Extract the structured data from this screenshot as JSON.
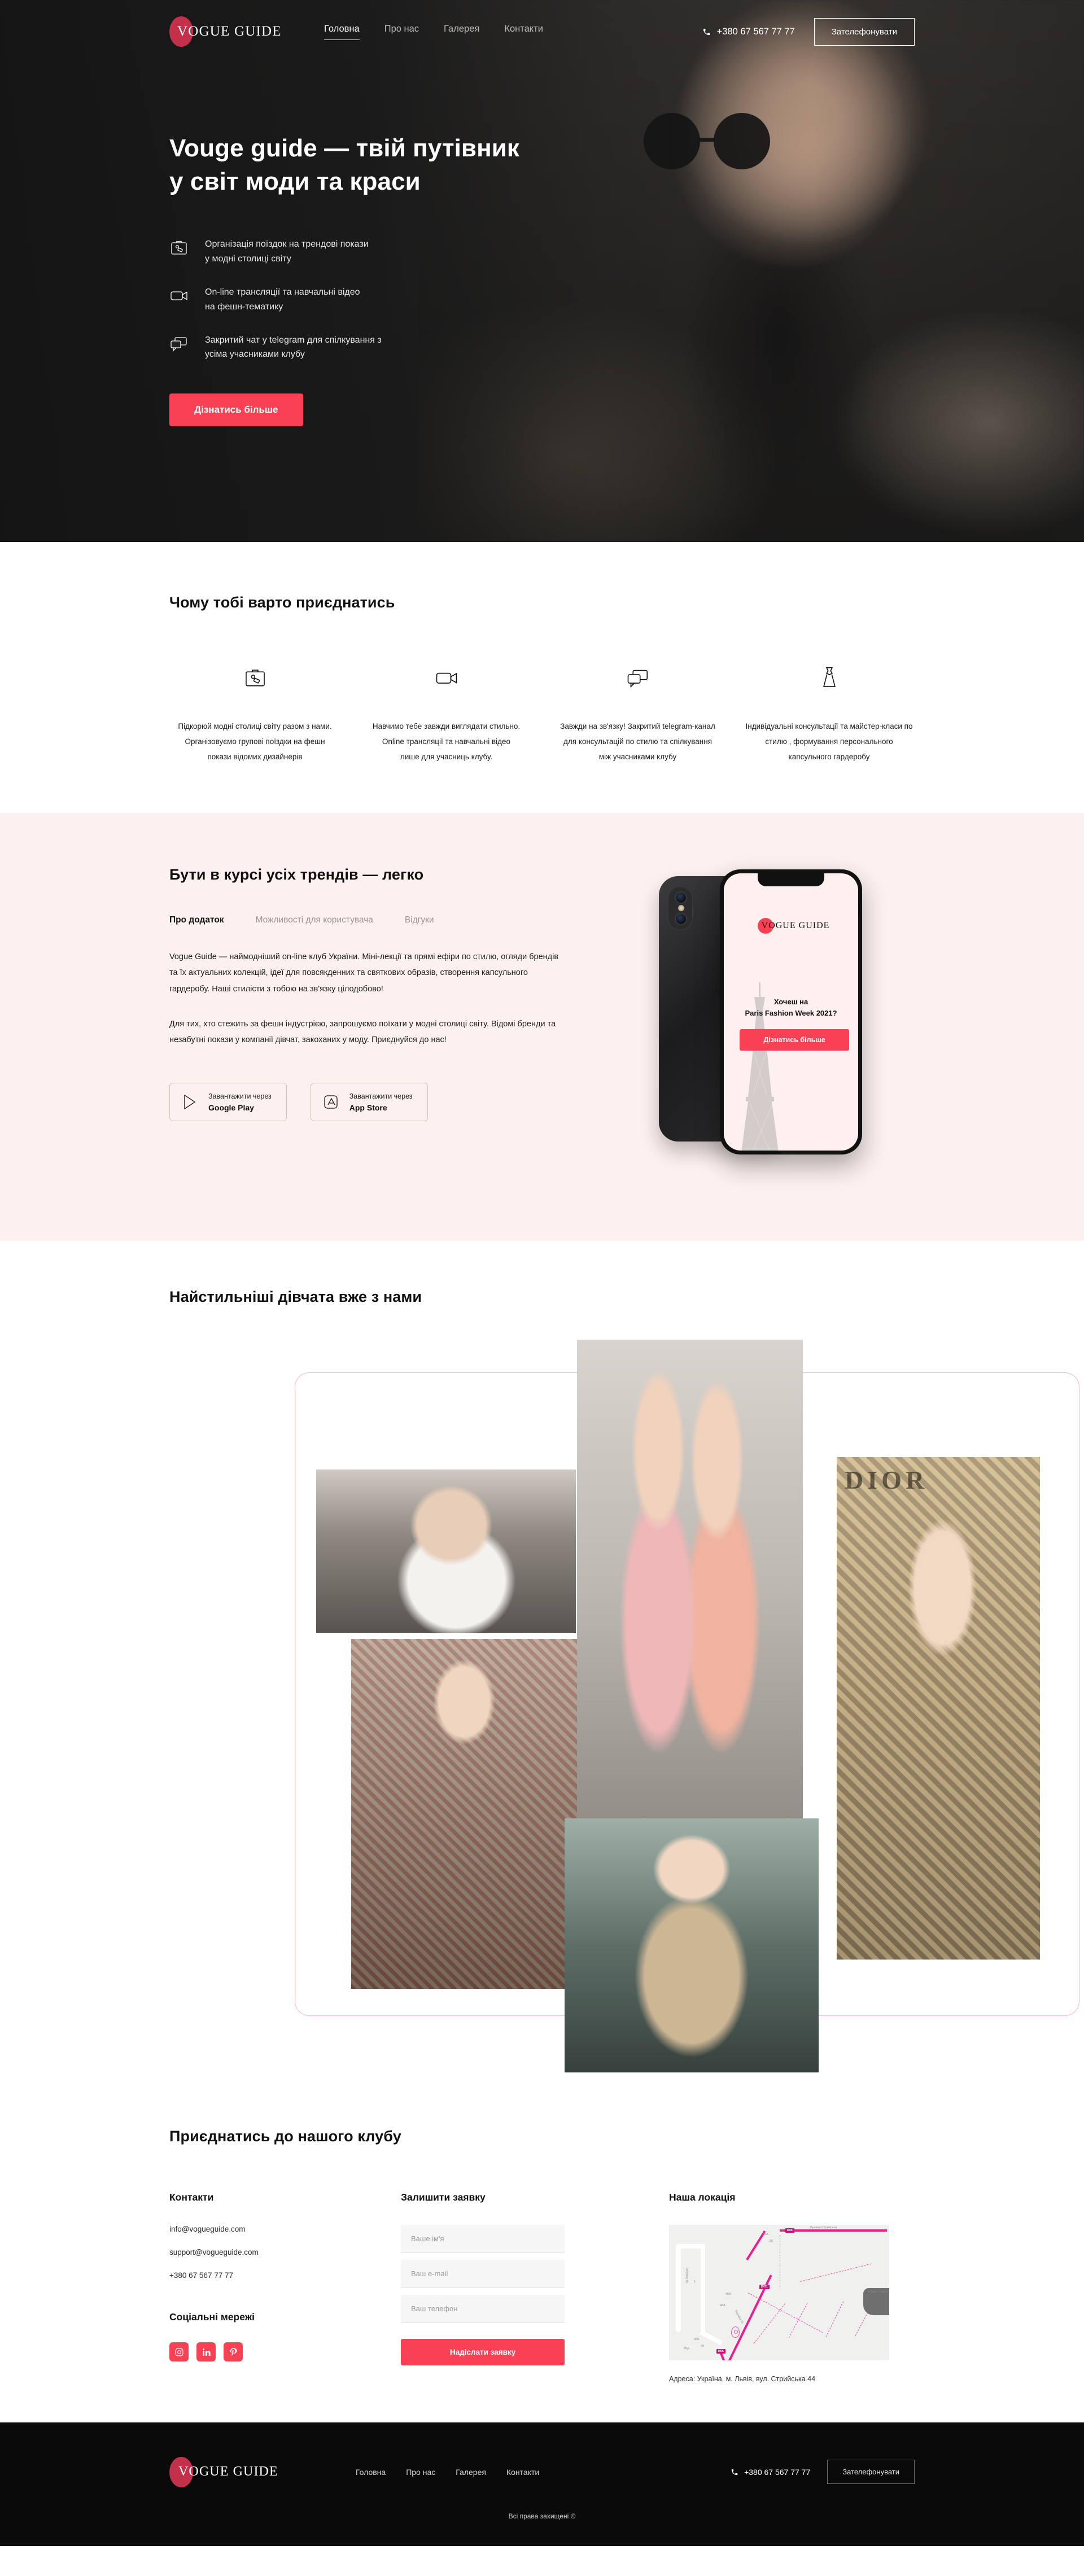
{
  "brand": {
    "name": "VOGUE GUIDE"
  },
  "colors": {
    "accent": "#fa4055",
    "logo_dot": "#c23049",
    "app_bg": "#fdf1ef",
    "footer_bg": "#0a0a0a"
  },
  "header": {
    "nav": [
      {
        "label": "Головна",
        "active": true
      },
      {
        "label": "Про нас",
        "active": false
      },
      {
        "label": "Галерея",
        "active": false
      },
      {
        "label": "Контакти",
        "active": false
      }
    ],
    "phone": "+380 67 567 77 77",
    "phone_icon": "phone-icon",
    "call_button": "Зателефонувати"
  },
  "hero": {
    "title_line1": "Vouge guide — твій путівник",
    "title_line2": "у світ моди та краси",
    "features": [
      {
        "icon": "suitcase-icon",
        "line1": "Організація поїздок на трендові покази",
        "line2": "у модні столиці світу"
      },
      {
        "icon": "video-camera-icon",
        "line1": "On-line трансляції та навчальні відео",
        "line2": "на фешн-тематику"
      },
      {
        "icon": "chat-bubbles-icon",
        "line1": "Закритий чат у telegram для спілкування з",
        "line2": "усіма учасниками клубу"
      }
    ],
    "cta": "Дізнатись більше"
  },
  "benefits": {
    "title": "Чому тобі варто приєднатись",
    "items": [
      {
        "icon": "suitcase-icon",
        "l1": "Підкорюй модні столиці світу разом з нами.",
        "l2": "Організовуємо групові поїздки на фешн",
        "l3": "покази відомих дизайнерів"
      },
      {
        "icon": "video-camera-icon",
        "l1": "Навчимо тебе завжди виглядати стильно.",
        "l2": "Online трансляції та навчальні відео",
        "l3": "лише для учасниць клубу."
      },
      {
        "icon": "chat-bubbles-icon",
        "l1": "Завжди на зв'язку! Закритий telegram-канал",
        "l2": "для консультацій по стилю та спілкування",
        "l3": "між учасниками клубу"
      },
      {
        "icon": "dress-icon",
        "l1": "Індивідуальні консультації та майстер-класи по",
        "l2": "стилю , формування персонального",
        "l3": "капсульного гардеробу"
      }
    ]
  },
  "app": {
    "title": "Бути в курсі усіх трендів — легко",
    "tabs": [
      {
        "label": "Про додаток",
        "active": true
      },
      {
        "label": "Можливості для користувача",
        "active": false
      },
      {
        "label": "Відгуки",
        "active": false
      }
    ],
    "paragraph1": "Vogue Guide —  наймодніший on-line клуб України.  Міні-лекції та прямі ефіри по стилю, огляди брендів та їх актуальних колекцій, ідеї для повсякденних та святкових образів, створення капсульного гардеробу. Наші стилісти з тобою на зв'язку цілодобово!",
    "paragraph2": "Для тих, хто стежить за фешн індустрією, запрошуємо поїхати у модні столиці світу. Відомі бренди та незабутні покази у компанії дівчат, закоханих у моду. Приєднуйся до нас!",
    "stores": [
      {
        "icon": "google-play-icon",
        "small": "Завантажити через",
        "big": "Google Play"
      },
      {
        "icon": "app-store-icon",
        "small": "Завантажити через",
        "big": "App Store"
      }
    ],
    "phone_screen": {
      "logo": "VOGUE GUIDE",
      "head_line1": "Хочеш на",
      "head_line2": "Paris Fashion Week 2021?",
      "button": "Дізнатись більше",
      "illustration": "eiffel-tower-icon"
    }
  },
  "gallery": {
    "title": "Найстильніші дівчата вже з нами",
    "photos": [
      {
        "name": "street-style-scooter",
        "alt": "Дівчина у білому жакеті біля скутера"
      },
      {
        "name": "street-style-pink-duo",
        "alt": "Дві дівчини у рожевих образах"
      },
      {
        "name": "street-style-plaid",
        "alt": "Дівчина у картатому костюмі"
      },
      {
        "name": "street-style-trench-duo",
        "alt": "Дві дівчини у тренчах"
      },
      {
        "name": "street-style-dior",
        "alt": "Дівчина у картатому пальті біля вивіски DIOR",
        "overlay_text": "DIOR"
      }
    ]
  },
  "contact": {
    "title": "Приєднатись до нашого клубу",
    "contacts_heading": "Контакти",
    "contacts": [
      "info@vogueguide.com",
      "support@vogueguide.com",
      "+380 67 567 77 77"
    ],
    "social_heading": "Соціальні мережі",
    "social": [
      {
        "name": "instagram-icon",
        "glyph": "instagram"
      },
      {
        "name": "linkedin-icon",
        "glyph": "in"
      },
      {
        "name": "pinterest-icon",
        "glyph": "P"
      }
    ],
    "form_heading": "Залишити заявку",
    "fields": [
      {
        "name": "name-field",
        "placeholder": "Ваше ім'я",
        "value": ""
      },
      {
        "name": "email-field",
        "placeholder": "Ваш e-mail",
        "value": ""
      },
      {
        "name": "phone-field",
        "placeholder": "Ваш телефон",
        "value": ""
      }
    ],
    "submit": "Надіслати заявку",
    "location_heading": "Наша локація",
    "address": "Адреса: Україна, м. Львів, вул. Стрийська 44",
    "map": {
      "streets": [
        "Dzyndry St",
        "Stryiska St",
        "Вулиця Стрийська"
      ],
      "shields": [
        "M06",
        "E471",
        "M06"
      ],
      "numbers": [
        "36A",
        "36",
        "30",
        "1",
        "46A",
        "46A",
        "46Б",
        "46",
        "46Д"
      ],
      "lake": "Ozero / Озеро"
    }
  },
  "footer": {
    "nav": [
      {
        "label": "Головна"
      },
      {
        "label": "Про нас"
      },
      {
        "label": "Галерея"
      },
      {
        "label": "Контакти"
      }
    ],
    "phone": "+380 67 567 77 77",
    "call_button": "Зателефонувати",
    "copyright": "Всі права захищені ©"
  }
}
